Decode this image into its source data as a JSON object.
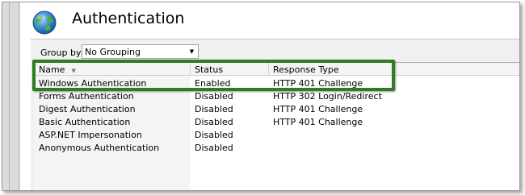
{
  "header": {
    "title": "Authentication",
    "icon": "globe-icon"
  },
  "toolbar": {
    "group_by_label": "Group by:",
    "group_by_value": "No Grouping"
  },
  "table": {
    "columns": [
      "Name",
      "Status",
      "Response Type"
    ],
    "rows": [
      {
        "name": "Windows Authentication",
        "status": "Enabled",
        "response": "HTTP 401 Challenge"
      },
      {
        "name": "Forms Authentication",
        "status": "Disabled",
        "response": "HTTP 302 Login/Redirect"
      },
      {
        "name": "Digest Authentication",
        "status": "Disabled",
        "response": "HTTP 401 Challenge"
      },
      {
        "name": "Basic Authentication",
        "status": "Disabled",
        "response": "HTTP 401 Challenge"
      },
      {
        "name": "ASP.NET Impersonation",
        "status": "Disabled",
        "response": ""
      },
      {
        "name": "Anonymous Authentication",
        "status": "Disabled",
        "response": ""
      }
    ]
  },
  "colors": {
    "highlight": "#2e7d22"
  }
}
